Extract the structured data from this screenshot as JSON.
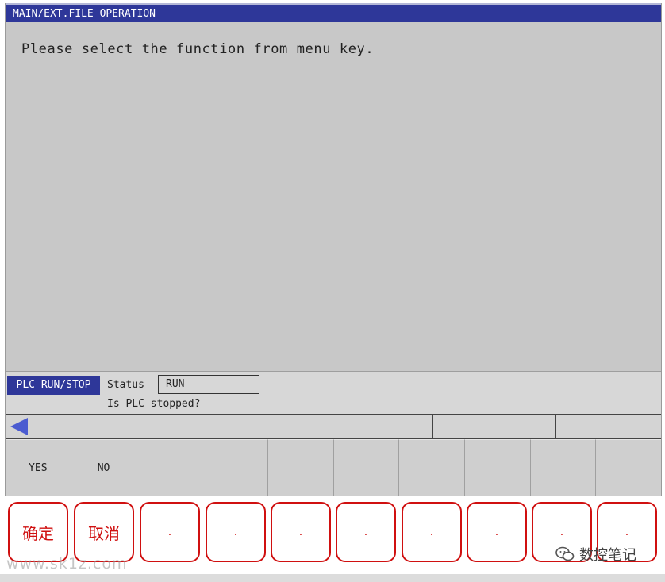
{
  "window": {
    "title": "MAIN/EXT.FILE OPERATION"
  },
  "main": {
    "message": "Please select the function from menu key."
  },
  "status_area": {
    "plc_label": "PLC RUN/STOP",
    "status_label": "Status",
    "status_value": "RUN",
    "prompt": "Is PLC stopped?"
  },
  "softkeys": [
    "YES",
    "NO",
    "",
    "",
    "",
    "",
    "",
    "",
    "",
    ""
  ],
  "annotations": [
    "确定",
    "取消",
    ".",
    ".",
    ".",
    ".",
    ".",
    ".",
    ".",
    "."
  ],
  "watermarks": {
    "left": "www.sk1z.com",
    "right": "数控笔记"
  },
  "colors": {
    "titlebar": "#2e3799",
    "annotation": "#d01010",
    "screen_bg": "#c8c8c8"
  },
  "icons": {
    "scroll_left": "triangle-left-icon",
    "wechat": "wechat-icon"
  }
}
